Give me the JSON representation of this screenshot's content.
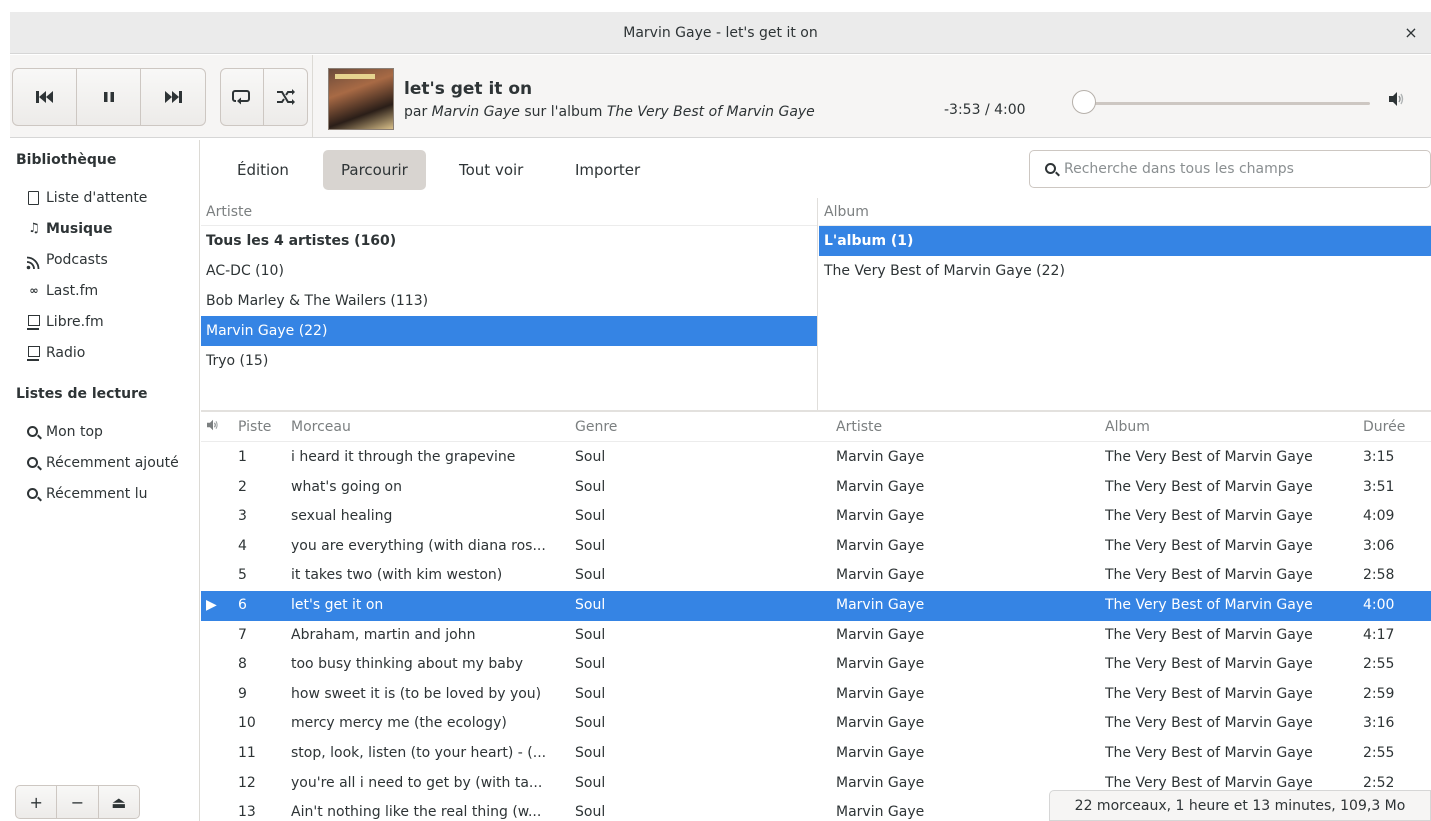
{
  "window": {
    "title": "Marvin Gaye - let's get it on",
    "close_label": "×"
  },
  "header": {
    "transport": {
      "previous_icon": "⏮",
      "pause_icon": "⏸",
      "next_icon": "⏭"
    },
    "modes": {
      "repeat_icon": "🔁",
      "shuffle_icon": "🔀"
    },
    "now_playing": {
      "title": "let's get it on",
      "by_prefix": "par ",
      "artist": "Marvin Gaye",
      "album_prefix": " sur l'album ",
      "album": "The Very Best of Marvin Gaye"
    },
    "time": "-3:53 / 4:00",
    "progress_fraction": 0.0,
    "volume_icon": "speaker-icon"
  },
  "sidebar": {
    "library_heading": "Bibliothèque",
    "library_items": [
      {
        "label": "Liste d'attente",
        "icon": "document-icon",
        "active": false
      },
      {
        "label": "Musique",
        "icon": "music-note-icon",
        "active": true
      },
      {
        "label": "Podcasts",
        "icon": "rss-icon",
        "active": false
      },
      {
        "label": "Last.fm",
        "icon": "lastfm-icon",
        "active": false
      },
      {
        "label": "Libre.fm",
        "icon": "monitor-icon",
        "active": false
      },
      {
        "label": "Radio",
        "icon": "monitor-icon",
        "active": false
      }
    ],
    "playlists_heading": "Listes de lecture",
    "playlist_items": [
      {
        "label": "Mon top",
        "icon": "search-icon"
      },
      {
        "label": "Récemment ajouté",
        "icon": "search-icon"
      },
      {
        "label": "Récemment lu",
        "icon": "search-icon"
      }
    ],
    "bottom_buttons": {
      "add": "+",
      "remove": "−",
      "eject": "⏏"
    }
  },
  "tabs": [
    {
      "label": "Édition",
      "active": false
    },
    {
      "label": "Parcourir",
      "active": true
    },
    {
      "label": "Tout voir",
      "active": false
    },
    {
      "label": "Importer",
      "active": false
    }
  ],
  "search": {
    "placeholder": "Recherche dans tous les champs",
    "value": ""
  },
  "browser": {
    "artist_header": "Artiste",
    "artists": [
      {
        "label": "Tous les 4 artistes (160)",
        "bold": true,
        "selected": false
      },
      {
        "label": "AC-DC (10)",
        "bold": false,
        "selected": false
      },
      {
        "label": "Bob Marley & The Wailers (113)",
        "bold": false,
        "selected": false
      },
      {
        "label": "Marvin Gaye (22)",
        "bold": false,
        "selected": true
      },
      {
        "label": "Tryo (15)",
        "bold": false,
        "selected": false
      }
    ],
    "album_header": "Album",
    "albums": [
      {
        "label": "L'album (1)",
        "bold": true,
        "selected": true
      },
      {
        "label": "The Very Best of Marvin Gaye (22)",
        "bold": false,
        "selected": false
      }
    ]
  },
  "tracklist": {
    "columns": {
      "playing": "speaker-icon",
      "piste": "Piste",
      "morceau": "Morceau",
      "genre": "Genre",
      "artiste": "Artiste",
      "album": "Album",
      "duree": "Durée"
    },
    "playing_indicator": "▶",
    "rows": [
      {
        "piste": "1",
        "morceau": "i heard it through the grapevine",
        "genre": "Soul",
        "artiste": "Marvin Gaye",
        "album": "The Very Best of Marvin Gaye",
        "duree": "3:15",
        "playing": false
      },
      {
        "piste": "2",
        "morceau": "what's going on",
        "genre": "Soul",
        "artiste": "Marvin Gaye",
        "album": "The Very Best of Marvin Gaye",
        "duree": "3:51",
        "playing": false
      },
      {
        "piste": "3",
        "morceau": "sexual healing",
        "genre": "Soul",
        "artiste": "Marvin Gaye",
        "album": "The Very Best of Marvin Gaye",
        "duree": "4:09",
        "playing": false
      },
      {
        "piste": "4",
        "morceau": "you are everything (with diana ros...",
        "genre": "Soul",
        "artiste": "Marvin Gaye",
        "album": "The Very Best of Marvin Gaye",
        "duree": "3:06",
        "playing": false
      },
      {
        "piste": "5",
        "morceau": "it takes two (with kim weston)",
        "genre": "Soul",
        "artiste": "Marvin Gaye",
        "album": "The Very Best of Marvin Gaye",
        "duree": "2:58",
        "playing": false
      },
      {
        "piste": "6",
        "morceau": "let's get it on",
        "genre": "Soul",
        "artiste": "Marvin Gaye",
        "album": "The Very Best of Marvin Gaye",
        "duree": "4:00",
        "playing": true
      },
      {
        "piste": "7",
        "morceau": "Abraham, martin and john",
        "genre": "Soul",
        "artiste": "Marvin Gaye",
        "album": "The Very Best of Marvin Gaye",
        "duree": "4:17",
        "playing": false
      },
      {
        "piste": "8",
        "morceau": "too busy thinking about my baby",
        "genre": "Soul",
        "artiste": "Marvin Gaye",
        "album": "The Very Best of Marvin Gaye",
        "duree": "2:55",
        "playing": false
      },
      {
        "piste": "9",
        "morceau": "how sweet it is (to be loved by you)",
        "genre": "Soul",
        "artiste": "Marvin Gaye",
        "album": "The Very Best of Marvin Gaye",
        "duree": "2:59",
        "playing": false
      },
      {
        "piste": "10",
        "morceau": "mercy mercy me (the ecology)",
        "genre": "Soul",
        "artiste": "Marvin Gaye",
        "album": "The Very Best of Marvin Gaye",
        "duree": "3:16",
        "playing": false
      },
      {
        "piste": "11",
        "morceau": "stop, look, listen (to your heart) - (...",
        "genre": "Soul",
        "artiste": "Marvin Gaye",
        "album": "The Very Best of Marvin Gaye",
        "duree": "2:55",
        "playing": false
      },
      {
        "piste": "12",
        "morceau": "you're all i need to get by (with ta...",
        "genre": "Soul",
        "artiste": "Marvin Gaye",
        "album": "The Very Best of Marvin Gaye",
        "duree": "2:52",
        "playing": false
      },
      {
        "piste": "13",
        "morceau": "Ain't nothing like the real thing (w...",
        "genre": "Soul",
        "artiste": "Marvin Gaye",
        "album": "",
        "duree": "",
        "playing": false
      }
    ]
  },
  "status": "22 morceaux, 1 heure et 13 minutes, 109,3 Mo",
  "colors": {
    "selection": "#3584e4",
    "headerbar": "#f6f5f4",
    "titlebar": "#ebebeb",
    "text": "#2e3436"
  }
}
